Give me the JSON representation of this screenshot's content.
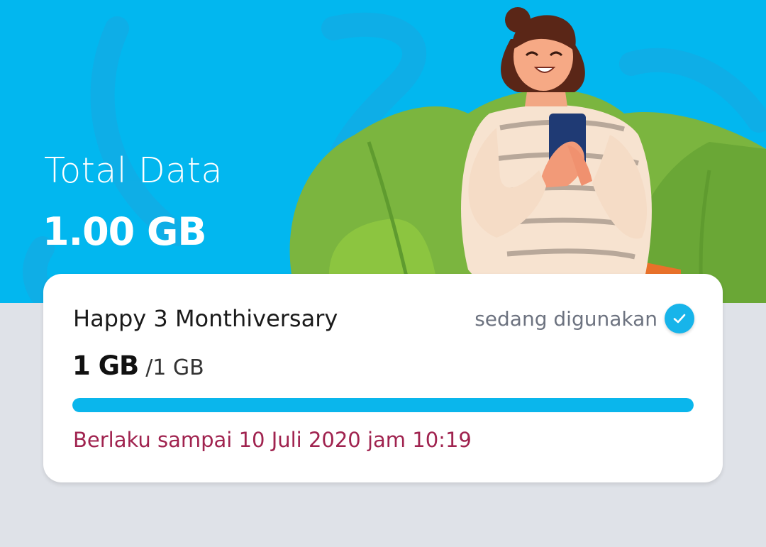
{
  "hero": {
    "title": "Total Data",
    "amount": "1.00 GB",
    "illustration": "woman-smiling-with-phone"
  },
  "package": {
    "name": "Happy 3 Monthiversary",
    "status": "sedang digunakan",
    "status_icon": "check-circle-icon",
    "remaining": "1 GB",
    "total": "/1 GB",
    "usage_fraction": 1.0,
    "validity": "Berlaku sampai 10 Juli 2020 jam 10:19"
  },
  "colors": {
    "hero_bg": "#02b7ef",
    "progress": "#0ab6ec",
    "validity_text": "#a0234f",
    "page_bg": "#dfe2e8"
  }
}
